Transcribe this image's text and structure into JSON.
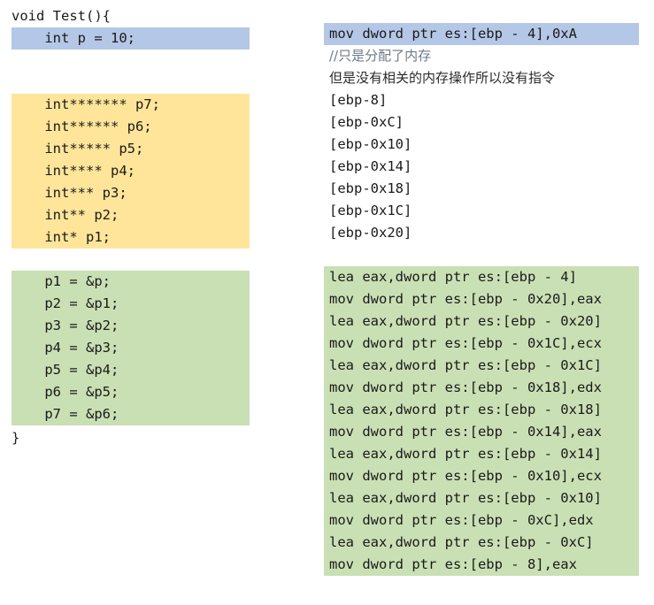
{
  "left": {
    "signature": "void Test(){",
    "highlighted_declaration": "    int p = 10;",
    "pointer_declarations": [
      "    int******* p7;",
      "    int****** p6;",
      "    int***** p5;",
      "    int**** p4;",
      "    int*** p3;",
      "    int** p2;",
      "    int* p1;"
    ],
    "assignments": [
      "    p1 = &p;",
      "    p2 = &p1;",
      "    p3 = &p2;",
      "    p4 = &p3;",
      "    p5 = &p4;",
      "    p6 = &p5;",
      "    p7 = &p6;"
    ],
    "closing_brace": "}"
  },
  "right": {
    "highlighted_instruction": "mov dword ptr es:[ebp - 4],0xA",
    "comment_line_1": "//只是分配了内存",
    "comment_line_2": "但是没有相关的内存操作所以没有指令",
    "stack_slots": [
      "[ebp-8]",
      "[ebp-0xC]",
      "[ebp-0x10]",
      "[ebp-0x14]",
      "[ebp-0x18]",
      "[ebp-0x1C]",
      "[ebp-0x20]"
    ],
    "assembly": [
      "lea eax,dword ptr es:[ebp - 4]",
      "mov dword ptr es:[ebp - 0x20],eax",
      "lea eax,dword ptr es:[ebp - 0x20]",
      "mov dword ptr es:[ebp - 0x1C],ecx",
      "lea eax,dword ptr es:[ebp - 0x1C]",
      "mov dword ptr es:[ebp - 0x18],edx",
      "lea eax,dword ptr es:[ebp - 0x18]",
      "mov dword ptr es:[ebp - 0x14],eax",
      "lea eax,dword ptr es:[ebp - 0x14]",
      "mov dword ptr es:[ebp - 0x10],ecx",
      "lea eax,dword ptr es:[ebp - 0x10]",
      "mov dword ptr es:[ebp - 0xC],edx",
      "lea eax,dword ptr es:[ebp - 0xC]",
      "mov dword ptr es:[ebp - 8],eax"
    ]
  },
  "colors": {
    "highlight_blue": "#b4c7e7",
    "highlight_yellow": "#ffe59a",
    "highlight_green": "#c9e0b4",
    "text": "#1a1a1a",
    "comment_text": "#6f7a86",
    "background": "#ffffff"
  }
}
